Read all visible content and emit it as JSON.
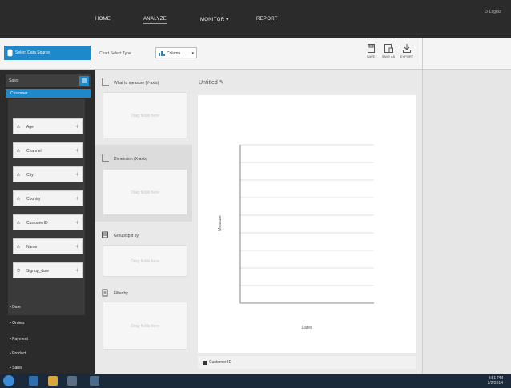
{
  "nav": {
    "items": [
      "HOME",
      "ANALYZE",
      "MONITOR",
      "REPORT"
    ],
    "monitor_caret": "▾",
    "user": "Logout"
  },
  "toolbar": {
    "dataset_button": "Select Data Source",
    "chart_label": "Chart  Select Type",
    "chart_select_value": "Column",
    "tools": [
      "SAVE",
      "SAVE AS",
      "EXPORT"
    ]
  },
  "sidebar": {
    "header": "Sales",
    "active_item": "Customer",
    "fields": [
      "Age",
      "Channel",
      "City",
      "Country",
      "CustomerID",
      "Name",
      "Signup_date"
    ],
    "categories": [
      "Date",
      "Orders",
      "Payment",
      "Product",
      "Sales"
    ]
  },
  "zones": [
    {
      "title": "What to measure (Y-axis)",
      "placeholder": "Drag fields here"
    },
    {
      "title": "Dimension (X-axis)",
      "placeholder": "Drag fields here"
    },
    {
      "title": "Group/split by",
      "placeholder": "Drag fields here"
    },
    {
      "title": "Filter by",
      "placeholder": "Drag fields here"
    }
  ],
  "chart": {
    "title": "Untitled",
    "edit_icon": "✎",
    "y_label": "Measure",
    "x_label": "Dates",
    "legend": "Customer ID"
  },
  "taskbar": {
    "time": "4:51 PM",
    "date": "1/2/2014"
  },
  "colors": {
    "accent": "#1e88c9",
    "nav_bg": "#2b2b2b",
    "active_underline": "#8bbf3a"
  }
}
